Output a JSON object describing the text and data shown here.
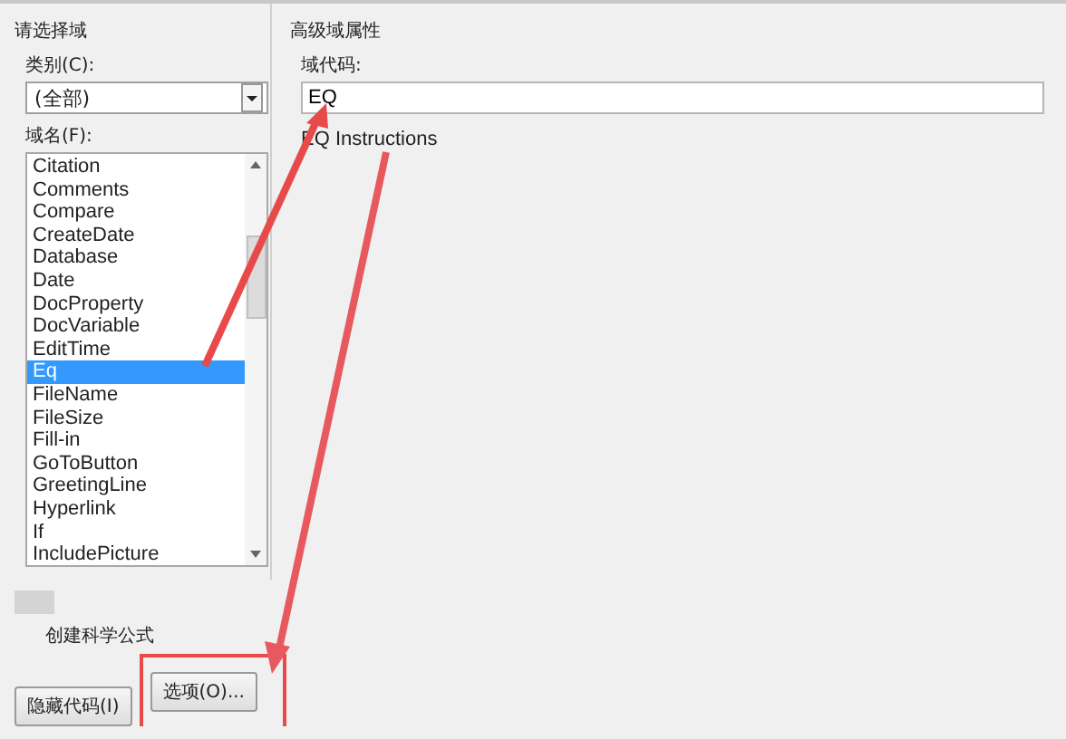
{
  "left_panel": {
    "title": "请选择域",
    "category_label": "类别(C):",
    "category_value": "(全部)",
    "field_names_label": "域名(F):",
    "field_names": [
      {
        "label": "Citation",
        "selected": false
      },
      {
        "label": "Comments",
        "selected": false
      },
      {
        "label": "Compare",
        "selected": false
      },
      {
        "label": "CreateDate",
        "selected": false
      },
      {
        "label": "Database",
        "selected": false
      },
      {
        "label": "Date",
        "selected": false
      },
      {
        "label": "DocProperty",
        "selected": false
      },
      {
        "label": "DocVariable",
        "selected": false
      },
      {
        "label": "EditTime",
        "selected": false
      },
      {
        "label": "Eq",
        "selected": true
      },
      {
        "label": "FileName",
        "selected": false
      },
      {
        "label": "FileSize",
        "selected": false
      },
      {
        "label": "Fill-in",
        "selected": false
      },
      {
        "label": "GoToButton",
        "selected": false
      },
      {
        "label": "GreetingLine",
        "selected": false
      },
      {
        "label": "Hyperlink",
        "selected": false
      },
      {
        "label": "If",
        "selected": false
      },
      {
        "label": "IncludePicture",
        "selected": false
      }
    ]
  },
  "right_panel": {
    "title": "高级域属性",
    "field_code_label": "域代码:",
    "field_code_value": "EQ",
    "hint": "EQ Instructions"
  },
  "description": "创建科学公式",
  "buttons": [
    {
      "label": "隐藏代码(I)",
      "highlighted": false
    },
    {
      "label": "选项(O)...",
      "highlighted": true
    }
  ]
}
